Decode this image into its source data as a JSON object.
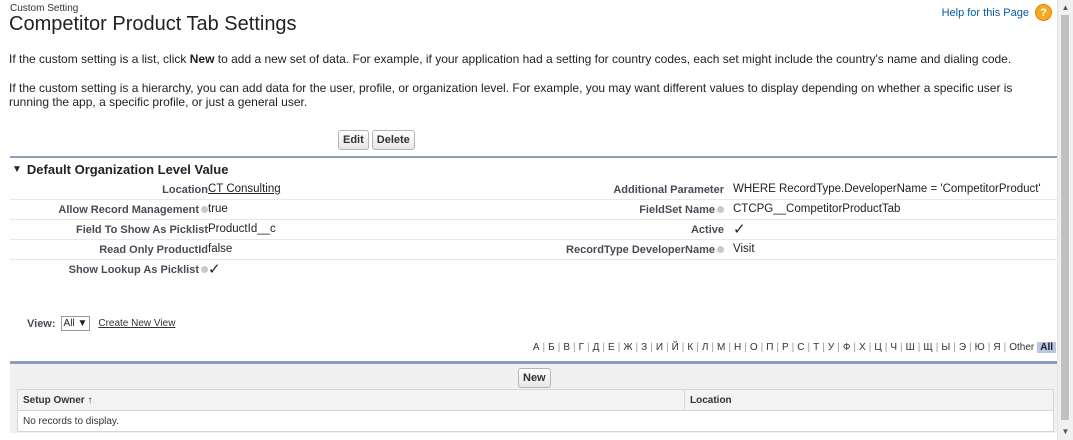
{
  "header": {
    "eyebrow": "Custom Setting",
    "title": "Competitor Product Tab Settings",
    "help_link": "Help for this Page",
    "help_icon": "?"
  },
  "intro": {
    "p1_before": "If the custom setting is a list, click ",
    "p1_bold": "New",
    "p1_after": " to add a new set of data. For example, if your application had a setting for country codes, each set might include the country's name and dialing code.",
    "p2": "If the custom setting is a hierarchy, you can add data for the user, profile, or organization level. For example, you may want different values to display depending on whether a specific user is running the app, a specific profile, or just a general user."
  },
  "buttons": {
    "edit": "Edit",
    "delete": "Delete"
  },
  "section": {
    "toggle": "▼",
    "title": "Default Organization Level Value",
    "rows": [
      {
        "l1": "Location",
        "v1": "CT Consulting",
        "l2": "Additional Parameter",
        "v2": "WHERE RecordType.DeveloperName = 'CompetitorProduct'"
      },
      {
        "l1": "Allow Record Management",
        "v1": "true",
        "l2": "FieldSet Name",
        "v2": "CTCPG__CompetitorProductTab"
      },
      {
        "l1": "Field To Show As Picklist",
        "v1": "ProductId__c",
        "l2": "Active",
        "v2": "✓"
      },
      {
        "l1": "Read Only ProductId",
        "v1": "false",
        "l2": "RecordType DeveloperName",
        "v2": "Visit"
      },
      {
        "l1": "Show Lookup As Picklist",
        "v1": "✓"
      }
    ]
  },
  "view": {
    "label": "View:",
    "selected": "All",
    "create_link": "Create New View"
  },
  "alphabet": [
    "А",
    "Б",
    "В",
    "Г",
    "Д",
    "Е",
    "Ж",
    "З",
    "И",
    "Й",
    "К",
    "Л",
    "М",
    "Н",
    "О",
    "П",
    "Р",
    "С",
    "Т",
    "У",
    "Ф",
    "Х",
    "Ц",
    "Ч",
    "Ш",
    "Щ",
    "Ы",
    "Э",
    "Ю",
    "Я",
    "Other"
  ],
  "alphabet_all": "All",
  "list": {
    "new_button": "New",
    "columns": [
      "Setup Owner ↑",
      "Location"
    ],
    "empty_message": "No records to display."
  },
  "scrollbar": {
    "up": "▲",
    "down": "▼"
  },
  "colors": {
    "link": "#015ba7",
    "section_border": "#8e9dbe",
    "help_icon": "#f4a820",
    "alpha_highlight": "#b8c6e5"
  }
}
